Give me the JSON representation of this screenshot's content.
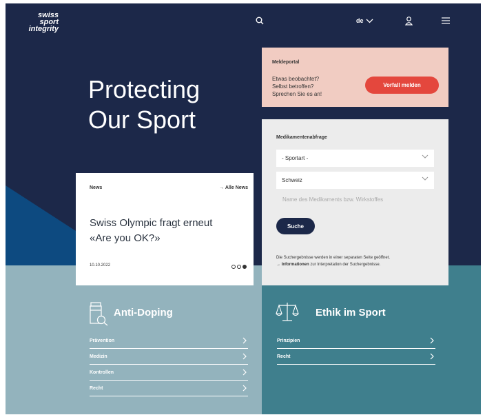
{
  "header": {
    "logo_line1": "swiss",
    "logo_line2": "sport",
    "logo_line3": "integrity",
    "language": "de"
  },
  "hero": {
    "title_line1": "Protecting",
    "title_line2": "Our Sport"
  },
  "report_portal": {
    "label": "Meldeportal",
    "text_line1": "Etwas beobachtet?",
    "text_line2": "Selbst betroffen?",
    "text_line3": "Sprechen Sie es an!",
    "button": "Vorfall melden"
  },
  "medication_search": {
    "label": "Medikamentenabfrage",
    "sport_select": "- Sportart -",
    "country_select": "Schweiz",
    "medication_placeholder": "Name des Medikaments bzw. Wirkstoffes",
    "button": "Suche",
    "note_line1": "Die Suchergebnisse werden in einer separaten Seite geöffnet.",
    "note_link": "Informationen",
    "note_line2_rest": " zur Interpretation der Suchergebnisse."
  },
  "news": {
    "label": "News",
    "all_link": "Alle News",
    "title_line1": "Swiss Olympic fragt erneut",
    "title_line2": "«Are you OK?»",
    "date": "10.10.2022",
    "slide_count": 3,
    "active_slide": 3
  },
  "anti_doping": {
    "title": "Anti-Doping",
    "items": [
      "Prävention",
      "Medizin",
      "Kontrollen",
      "Recht"
    ]
  },
  "ethics": {
    "title": "Ethik im Sport",
    "items": [
      "Prinzipien",
      "Recht"
    ]
  },
  "colors": {
    "navy": "#1c2849",
    "blue_wedge": "#0d4a80",
    "report_bg": "#f1ccc2",
    "report_button": "#e4473d",
    "anti_doping_bg": "#93b3bd",
    "ethics_bg": "#3f7f8d"
  },
  "icons": [
    "search-icon",
    "chevron-down-icon",
    "user-icon",
    "menu-icon",
    "pill-magnifier-icon",
    "scales-icon",
    "chevron-right-icon"
  ]
}
